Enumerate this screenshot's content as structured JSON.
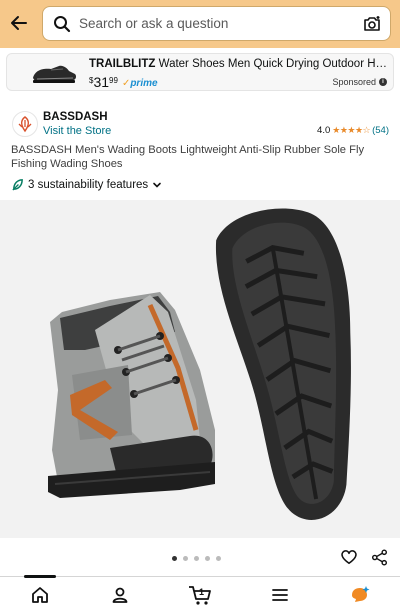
{
  "search": {
    "placeholder": "Search or ask a question"
  },
  "sponsored_ad": {
    "brand": "TRAILBLITZ",
    "title": "Water Shoes Men Quick Drying Outdoor Hiking...",
    "price_symbol": "$",
    "price_whole": "31",
    "price_cents": "99",
    "prime_label": "prime",
    "sponsored_label": "Sponsored"
  },
  "brand": {
    "name": "BASSDASH",
    "visit_store": "Visit the Store"
  },
  "rating": {
    "value": "4.0",
    "stars": "★★★★☆",
    "count": "(54)"
  },
  "product": {
    "title": "BASSDASH Men's Wading Boots Lightweight Anti-Slip Rubber Sole Fly Fishing Wading Shoes"
  },
  "sustainability": {
    "label": "3 sustainability features"
  },
  "gallery": {
    "image_count": 5,
    "active_index": 0
  },
  "colors": {
    "header": "#f6c88a",
    "link": "#007185",
    "star": "#e98a2a",
    "prime": "#1b8fd1",
    "leaf": "#067d62"
  },
  "bottom_nav": {
    "items": [
      {
        "icon": "home-icon"
      },
      {
        "icon": "account-icon"
      },
      {
        "icon": "cart-icon",
        "badge": "1"
      },
      {
        "icon": "menu-icon"
      },
      {
        "icon": "rufus-ai-icon"
      }
    ]
  }
}
